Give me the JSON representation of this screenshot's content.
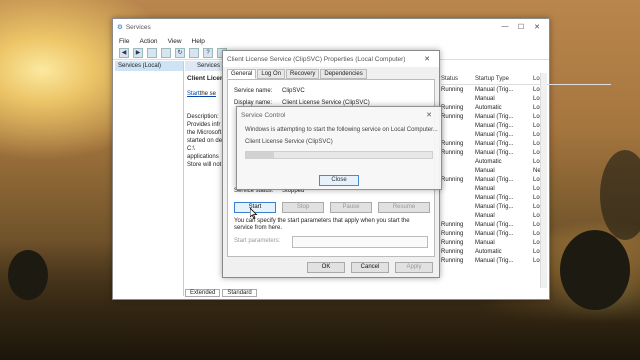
{
  "services_window": {
    "title": "Services",
    "menu": [
      "File",
      "Action",
      "View",
      "Help"
    ],
    "tree_item": "Services (Local)",
    "tab_label": "Services",
    "service_title": "Client License",
    "start_link": "Start",
    "start_suffix": "the se",
    "description_lines": [
      "Description:",
      "Provides infr",
      "the Microsoft",
      "started on de",
      "C:\\",
      "applications",
      "Store will not"
    ],
    "columns": {
      "status": "Status",
      "startup": "Startup Type",
      "logon": "Lo"
    },
    "rows": [
      {
        "status": "Running",
        "startup": "Manual (Trig...",
        "logon": "Loc"
      },
      {
        "status": "",
        "startup": "Manual",
        "logon": "Loc"
      },
      {
        "status": "Running",
        "startup": "Automatic",
        "logon": "Loc"
      },
      {
        "status": "Running",
        "startup": "Manual (Trig...",
        "logon": "Loc"
      },
      {
        "status": "",
        "startup": "Manual (Trig...",
        "logon": "Loc"
      },
      {
        "status": "",
        "startup": "Manual (Trig...",
        "logon": "Loc"
      },
      {
        "status": "Running",
        "startup": "Manual (Trig...",
        "logon": "Loc"
      },
      {
        "status": "Running",
        "startup": "Manual (Trig...",
        "logon": "Loc"
      },
      {
        "status": "",
        "startup": "Automatic",
        "logon": "Loc"
      },
      {
        "status": "",
        "startup": "Manual",
        "logon": "Net"
      },
      {
        "status": "Running",
        "startup": "Manual (Trig...",
        "logon": "Loc"
      },
      {
        "status": "",
        "startup": "Manual",
        "logon": "Loc"
      },
      {
        "status": "",
        "startup": "Manual (Trig...",
        "logon": "Loc"
      },
      {
        "status": "",
        "startup": "Manual (Trig...",
        "logon": "Loc"
      },
      {
        "status": "",
        "startup": "Manual",
        "logon": "Loc"
      },
      {
        "status": "Running",
        "startup": "Manual (Trig...",
        "logon": "Loc"
      },
      {
        "status": "Running",
        "startup": "Manual (Trig...",
        "logon": "Loc"
      },
      {
        "status": "Running",
        "startup": "Manual",
        "logon": "Loc"
      },
      {
        "status": "Running",
        "startup": "Automatic",
        "logon": "Loc"
      },
      {
        "status": "Running",
        "startup": "Manual (Trig...",
        "logon": "Loc"
      }
    ],
    "bottom_tabs": [
      "Extended",
      "Standard"
    ]
  },
  "properties_dialog": {
    "title": "Client License Service (ClipSVC) Properties (Local Computer)",
    "tabs": [
      "General",
      "Log On",
      "Recovery",
      "Dependencies"
    ],
    "service_name_label": "Service name:",
    "service_name_value": "ClipSVC",
    "display_name_label": "Display name:",
    "display_name_value": "Client License Service (ClipSVC)",
    "service_status_label": "Service status:",
    "service_status_value": "Stopped",
    "buttons": {
      "start": "Start",
      "stop": "Stop",
      "pause": "Pause",
      "resume": "Resume"
    },
    "help_text": "You can specify the start parameters that apply when you start the service from here.",
    "start_params_label": "Start parameters:",
    "ok": "OK",
    "cancel": "Cancel",
    "apply": "Apply"
  },
  "service_control": {
    "title": "Service Control",
    "message": "Windows is attempting to start the following service on Local Computer...",
    "service": "Client License Service (ClipSVC)",
    "close": "Close",
    "progress": 0.15
  }
}
